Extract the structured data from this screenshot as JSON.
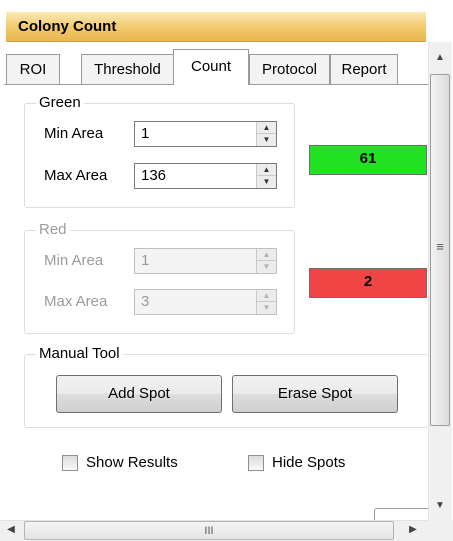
{
  "window": {
    "title": "Colony Count"
  },
  "tabs": [
    {
      "label": "ROI"
    },
    {
      "label": "Threshold"
    },
    {
      "label": "Count",
      "active": true
    },
    {
      "label": "Protocol"
    },
    {
      "label": "Report"
    }
  ],
  "green": {
    "label": "Green",
    "min_area_label": "Min Area",
    "min_area_value": "1",
    "max_area_label": "Max Area",
    "max_area_value": "136",
    "count": "61",
    "count_color": "#22e022"
  },
  "red": {
    "label": "Red",
    "min_area_label": "Min Area",
    "min_area_value": "1",
    "max_area_label": "Max Area",
    "max_area_value": "3",
    "count": "2",
    "count_color": "#f14545"
  },
  "manual_tool": {
    "label": "Manual Tool",
    "add_label": "Add Spot",
    "erase_label": "Erase Spot"
  },
  "options": {
    "show_results_label": "Show Results",
    "show_results_checked": false,
    "hide_spots_label": "Hide Spots",
    "hide_spots_checked": false
  },
  "scrollbars": {
    "hscroll_grip": "III",
    "vscroll_grip": "≡"
  }
}
